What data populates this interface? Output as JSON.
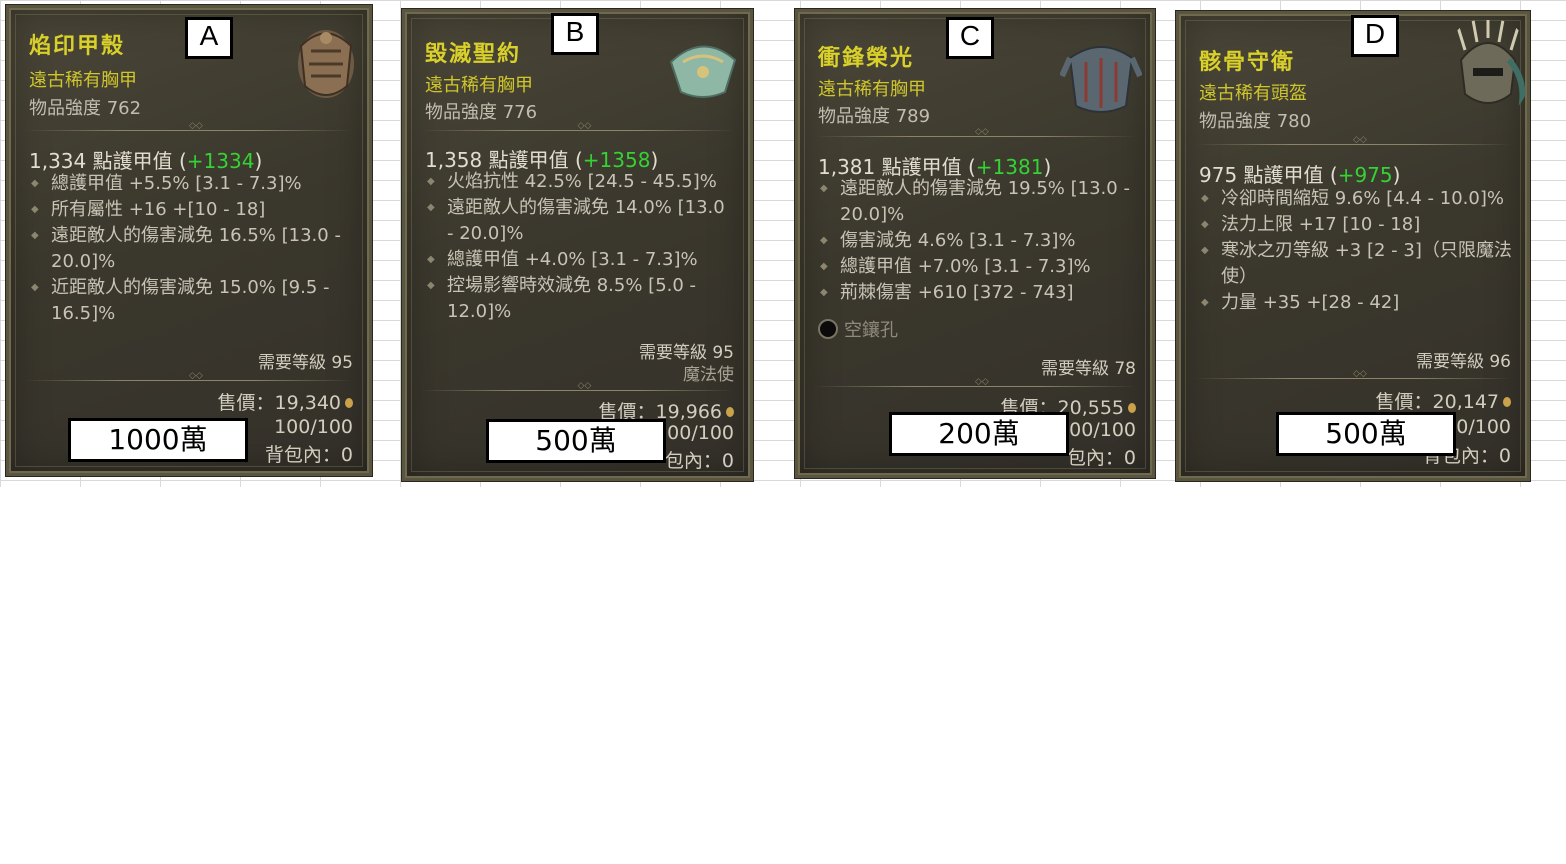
{
  "cards": [
    {
      "letter": "A",
      "name": "焰印甲殼",
      "rarity": "遠古稀有胸甲",
      "power": "物品強度 762",
      "armor_value": "1,334 點護甲值",
      "armor_bonus": "+1334",
      "affixes": [
        "總護甲值 +5.5% [3.1 - 7.3]%",
        "所有屬性 +16 +[10 - 18]",
        "遠距敵人的傷害減免 16.5% [13.0 - 20.0]%",
        "近距敵人的傷害減免 15.0% [9.5 - 16.5]%"
      ],
      "required_level": "需要等級 95",
      "sell_price": "售價：19,340",
      "durability": "100/100",
      "inventory": "背包內：0",
      "price_tag": "1000萬",
      "icon": "chest-armor-icon"
    },
    {
      "letter": "B",
      "name": "毀滅聖約",
      "rarity": "遠古稀有胸甲",
      "power": "物品強度 776",
      "armor_value": "1,358 點護甲值",
      "armor_bonus": "+1358",
      "affixes": [
        "火焰抗性 42.5% [24.5 - 45.5]%",
        "遠距敵人的傷害減免 14.0% [13.0 - 20.0]%",
        "總護甲值 +4.0% [3.1 - 7.3]%",
        "控場影響時效減免 8.5% [5.0 - 12.0]%"
      ],
      "required_level": "需要等級 95",
      "class_req": "魔法使",
      "sell_price": "售價：19,966",
      "durability": "100/100",
      "inventory": "包內：0",
      "price_tag": "500萬",
      "icon": "chest-armor-icon"
    },
    {
      "letter": "C",
      "name": "衝鋒榮光",
      "rarity": "遠古稀有胸甲",
      "power": "物品強度 789",
      "armor_value": "1,381 點護甲值",
      "armor_bonus": "+1381",
      "affixes": [
        "遠距敵人的傷害減免 19.5% [13.0 - 20.0]%",
        "傷害減免 4.6% [3.1 - 7.3]%",
        "總護甲值 +7.0% [3.1 - 7.3]%",
        "荊棘傷害 +610 [372 - 743]"
      ],
      "socket": "空鑲孔",
      "required_level": "需要等級 78",
      "sell_price": "售價：20,555",
      "durability": "00/100",
      "inventory": "包內：0",
      "price_tag": "200萬",
      "icon": "chest-armor-icon"
    },
    {
      "letter": "D",
      "name": "骸骨守衛",
      "rarity": "遠古稀有頭盔",
      "power": "物品強度 780",
      "armor_value": "975 點護甲值",
      "armor_bonus": "+975",
      "affixes": [
        "冷卻時間縮短 9.6% [4.4 - 10.0]%",
        "法力上限 +17 [10 - 18]",
        "寒冰之刃等級 +3 [2 - 3]（只限魔法使）",
        "力量 +35 +[28 - 42]"
      ],
      "required_level": "需要等級 96",
      "sell_price": "售價：20,147",
      "durability": "100/100",
      "inventory": "背包內：0",
      "price_tag": "500萬",
      "icon": "helm-icon"
    }
  ],
  "colors": {
    "item_name": "#d9d02a",
    "rarity": "#cfc62c",
    "armor_bonus": "#35d235",
    "card_bg": "#3b382d"
  }
}
